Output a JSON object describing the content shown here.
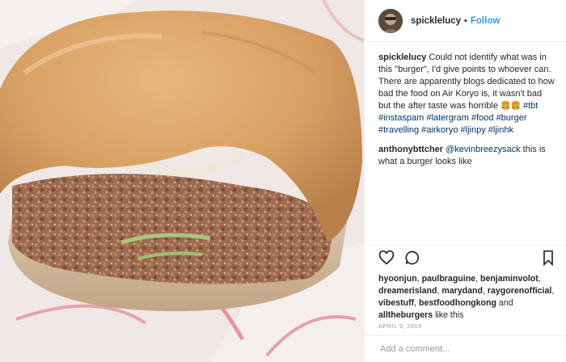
{
  "post": {
    "username": "spicklelucy",
    "separator": "•",
    "follow_label": "Follow",
    "caption_user": "spicklelucy",
    "caption_text": "Could not identify what was in this \"burger\", I'd give points to whoever can. There are apparently blogs dedicated to how bad the food on Air Koryo is, it wasn't bad but the after taste was horrible",
    "caption_emoji": "🍔🍔",
    "hashtags": [
      "#tbt",
      "#instaspam",
      "#latergram",
      "#food",
      "#burger",
      "#travelling",
      "#airkoryo",
      "#ljinpy",
      "#ljinhk"
    ],
    "comment": {
      "user": "anthonybttcher",
      "mention": "@kevinbreezysack",
      "text": "this is what a burger looks like"
    },
    "likes": {
      "users": [
        "hyoonjun",
        "paulbraguine",
        "benjaminvolot",
        "dreamerisland",
        "marydand",
        "raygorenofficial",
        "vibestuff",
        "bestfoodhongkong",
        "alltheburgers"
      ],
      "and_label": "and",
      "suffix": "like this"
    },
    "date": "April 9, 2015",
    "add_comment_placeholder": "Add a comment..."
  },
  "icons": {
    "like": "heart-icon",
    "comment": "comment-icon",
    "save": "bookmark-icon"
  },
  "colors": {
    "link_blue": "#3897f0",
    "hashtag": "#003569",
    "muted": "#999999"
  }
}
